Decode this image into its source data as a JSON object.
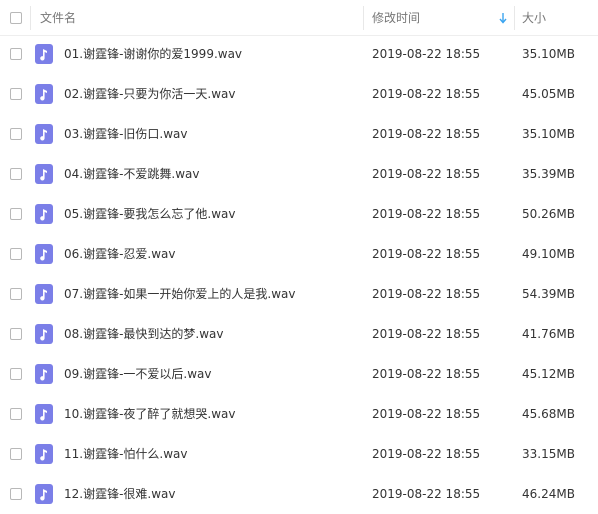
{
  "header": {
    "name_label": "文件名",
    "time_label": "修改时间",
    "size_label": "大小"
  },
  "colors": {
    "audio_icon": "#7b7fe8",
    "sort_arrow": "#3ba4f0"
  },
  "files": [
    {
      "name": "01.谢霆锋-谢谢你的爱1999.wav",
      "modified": "2019-08-22 18:55",
      "size": "35.10MB",
      "icon": "music-file-icon"
    },
    {
      "name": "02.谢霆锋-只要为你活一天.wav",
      "modified": "2019-08-22 18:55",
      "size": "45.05MB",
      "icon": "music-file-icon"
    },
    {
      "name": "03.谢霆锋-旧伤口.wav",
      "modified": "2019-08-22 18:55",
      "size": "35.10MB",
      "icon": "music-file-icon"
    },
    {
      "name": "04.谢霆锋-不爱跳舞.wav",
      "modified": "2019-08-22 18:55",
      "size": "35.39MB",
      "icon": "music-file-icon"
    },
    {
      "name": "05.谢霆锋-要我怎么忘了他.wav",
      "modified": "2019-08-22 18:55",
      "size": "50.26MB",
      "icon": "music-file-icon"
    },
    {
      "name": "06.谢霆锋-忍爱.wav",
      "modified": "2019-08-22 18:55",
      "size": "49.10MB",
      "icon": "music-file-icon"
    },
    {
      "name": "07.谢霆锋-如果一开始你爱上的人是我.wav",
      "modified": "2019-08-22 18:55",
      "size": "54.39MB",
      "icon": "music-file-icon"
    },
    {
      "name": "08.谢霆锋-最快到达的梦.wav",
      "modified": "2019-08-22 18:55",
      "size": "41.76MB",
      "icon": "music-file-icon"
    },
    {
      "name": "09.谢霆锋-一不爱以后.wav",
      "modified": "2019-08-22 18:55",
      "size": "45.12MB",
      "icon": "music-file-icon"
    },
    {
      "name": "10.谢霆锋-夜了醉了就想哭.wav",
      "modified": "2019-08-22 18:55",
      "size": "45.68MB",
      "icon": "music-file-icon"
    },
    {
      "name": "11.谢霆锋-怕什么.wav",
      "modified": "2019-08-22 18:55",
      "size": "33.15MB",
      "icon": "music-file-icon"
    },
    {
      "name": "12.谢霆锋-很难.wav",
      "modified": "2019-08-22 18:55",
      "size": "46.24MB",
      "icon": "music-file-icon"
    }
  ]
}
